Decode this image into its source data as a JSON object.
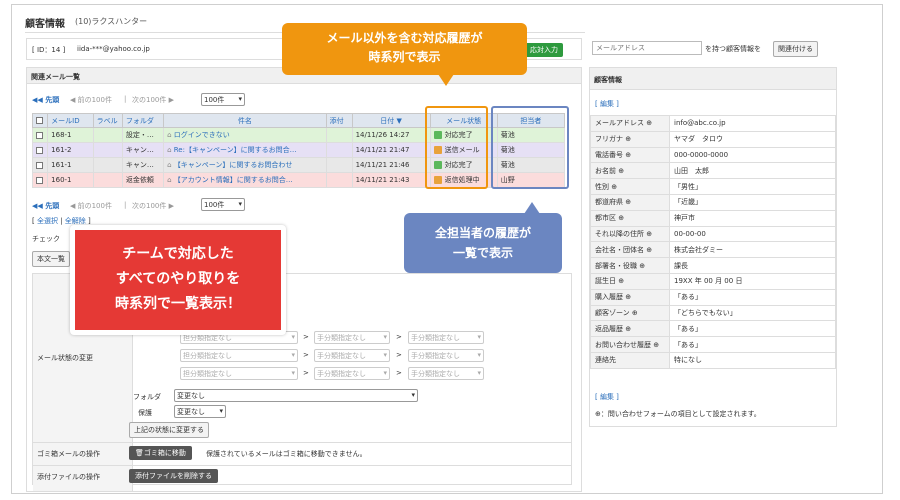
{
  "header": {
    "title": "顧客情報",
    "subtitle": "(10)ラクスハンター"
  },
  "id_bar": {
    "id_text": "[ ID：14 ]",
    "email": "iida-***@yahoo.co.jp",
    "manual_btn": "応対入力"
  },
  "search": {
    "placeholder": "メールアドレス",
    "suffix": "を持つ顧客情報を",
    "link_btn": "関連付ける"
  },
  "mail_list": {
    "title": "関連メール一覧",
    "pager": {
      "first": "◀◀ 先頭",
      "prev": "◀ 前の100件",
      "sep": "|",
      "next": "次の100件 ▶",
      "per_page": "100件"
    },
    "columns": [
      "",
      "メールID",
      "ラベル",
      "フォルダ",
      "件名",
      "添付",
      "日付 ▼",
      "メール状態",
      "担当者"
    ],
    "rows": [
      {
        "id": "168-1",
        "label": "",
        "folder": "設定・…",
        "subject": "ログインできない",
        "attach": "",
        "date": "14/11/26 14:27",
        "status": "対応完了",
        "status_color": "#5cb85c",
        "assignee": "菊池",
        "style": "row-green"
      },
      {
        "id": "161-2",
        "label": "",
        "folder": "キャン…",
        "subject": "Re:【キャンペーン】に関するお問合…",
        "attach": "",
        "date": "14/11/21 21:47",
        "status": "送信メール",
        "status_color": "#e8a23a",
        "assignee": "菊池",
        "style": "row-purple"
      },
      {
        "id": "161-1",
        "label": "",
        "folder": "キャン…",
        "subject": "【キャンペーン】に関するお問合わせ",
        "attach": "",
        "date": "14/11/21 21:46",
        "status": "対応完了",
        "status_color": "#5cb85c",
        "assignee": "菊池",
        "style": "row-gray"
      },
      {
        "id": "160-1",
        "label": "",
        "folder": "返金依頼",
        "subject": "【アカウント情報】に関するお問合…",
        "attach": "",
        "date": "14/11/21 21:43",
        "status": "返信処理中",
        "status_color": "#e8a23a",
        "assignee": "山野",
        "style": "row-pink"
      }
    ],
    "select_all": "全選択",
    "deselect_all": "全解除",
    "check_label": "チェック",
    "body_btn": "本文一覧"
  },
  "bulk": {
    "status_change_label": "メール状態の変更",
    "unset1": "担分類指定なし",
    "unset2": "手分類指定なし",
    "folder_label": "フォルダ",
    "folder_value": "変更なし",
    "hold_label": "保護",
    "hold_value": "変更なし",
    "apply_btn": "上記の状態に変更する",
    "trash_label": "ゴミ箱メールの操作",
    "trash_btn": "🗑ゴミ箱に移動",
    "trash_note": "保護されているメールはゴミ箱に移動できません。",
    "attach_label": "添付ファイルの操作",
    "attach_btn": "添付ファイルを削除する"
  },
  "customer": {
    "title": "顧客情報",
    "edit": "[ 編集 ]",
    "fields": [
      {
        "label": "メールアドレス ⊕",
        "value": "info@abc.co.jp"
      },
      {
        "label": "フリガナ ⊕",
        "value": "ヤマダ　タロウ"
      },
      {
        "label": "電話番号 ⊕",
        "value": "000-0000-0000"
      },
      {
        "label": "お名前 ⊕",
        "value": "山田　太郎"
      },
      {
        "label": "性別 ⊕",
        "value": "「男性」"
      },
      {
        "label": "都道府県 ⊕",
        "value": "「近畿」"
      },
      {
        "label": "都市区 ⊕",
        "value": "神戸市"
      },
      {
        "label": "それ以降の住所 ⊕",
        "value": "00-00-00"
      },
      {
        "label": "会社名・団体名 ⊕",
        "value": "株式会社ダミー"
      },
      {
        "label": "部署名・役職 ⊕",
        "value": "課長"
      },
      {
        "label": "誕生日 ⊕",
        "value": "19XX 年 00 月 00 日"
      },
      {
        "label": "購入履歴 ⊕",
        "value": "「ある」"
      },
      {
        "label": "顧客ゾーン ⊕",
        "value": "「どちらでもない」"
      },
      {
        "label": "返品履歴 ⊕",
        "value": "「ある」"
      },
      {
        "label": "お問い合わせ履歴 ⊕",
        "value": "「ある」"
      },
      {
        "label": "連絡先",
        "value": "特になし"
      }
    ],
    "footnote": "⊕：問い合わせフォームの項目として設定されます。"
  },
  "callouts": {
    "orange": "メール以外を含む対応履歴が\n時系列で表示",
    "blue": "全担当者の履歴が\n一覧で表示",
    "red": "チームで対応した\nすべてのやり取りを\n時系列で一覧表示！"
  },
  "colors": {
    "orange": "#f0960f",
    "blue": "#6b86c1",
    "red": "#e53935",
    "link": "#2a6ebb",
    "green_btn": "#2e9a3e"
  }
}
